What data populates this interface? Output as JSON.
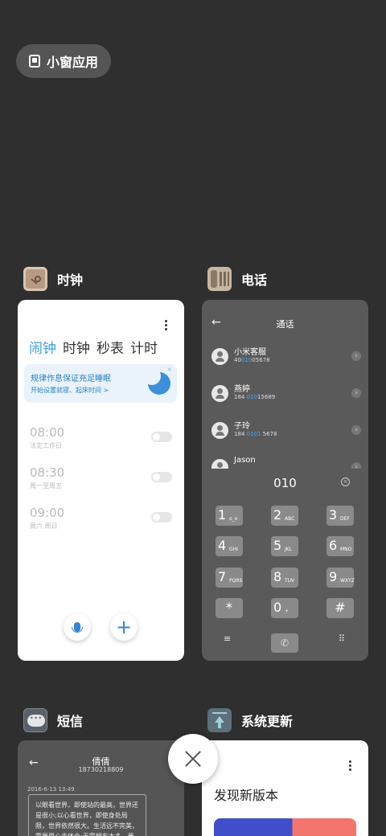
{
  "mini_apps": {
    "label": "小窗应用"
  },
  "apps": {
    "clock": {
      "title": "时钟"
    },
    "phone": {
      "title": "电话"
    },
    "sms": {
      "title": "短信"
    },
    "update": {
      "title": "系统更新"
    }
  },
  "clock": {
    "tabs": [
      "闹钟",
      "时钟",
      "秒表",
      "计时"
    ],
    "active_tab": "闹钟",
    "tip_title": "规律作息保证充足睡眠",
    "tip_sub": "开始设置就寝、起床时间 >",
    "tip_close": "×",
    "alarms": [
      {
        "time": "08:00",
        "sub": "法定工作日",
        "enabled": false
      },
      {
        "time": "08:30",
        "sub": "周一至周五",
        "enabled": false
      },
      {
        "time": "09:00",
        "sub": "周六 周日",
        "enabled": false
      }
    ],
    "plus": "+"
  },
  "phone": {
    "back": "←",
    "title": "通话",
    "contacts": [
      {
        "name": "小米客服",
        "num_pre": "40",
        "num_hl": "010",
        "num_post": "05678"
      },
      {
        "name": "燕婷",
        "num_pre": "184 ",
        "num_hl": "010",
        "num_post": "15689"
      },
      {
        "name": "子玲",
        "num_pre": "184 ",
        "num_hl": "0101",
        "num_post": " 5678"
      },
      {
        "name": "Jason",
        "num_pre": "",
        "num_hl": "",
        "num_post": ""
      }
    ],
    "chevron": "›",
    "dial_number": "010",
    "delete": "×",
    "keys": [
      {
        "d": "1",
        "l": "o_o"
      },
      {
        "d": "2",
        "l": "ABC"
      },
      {
        "d": "3",
        "l": "DEF"
      },
      {
        "d": "4",
        "l": "GHI"
      },
      {
        "d": "5",
        "l": "JKL"
      },
      {
        "d": "6",
        "l": "MNO"
      },
      {
        "d": "7",
        "l": "PQRS"
      },
      {
        "d": "8",
        "l": "TUV"
      },
      {
        "d": "9",
        "l": "WXYZ"
      },
      {
        "d": "*",
        "l": ""
      },
      {
        "d": "0",
        "l": "+"
      },
      {
        "d": "#",
        "l": ""
      }
    ],
    "menu": "≡",
    "call": "✆",
    "dialpad": "⠿"
  },
  "sms": {
    "back": "←",
    "name": "倩倩",
    "number": "18730218809",
    "date": "2016-6-13 13:49",
    "message": "以眼看世界，即使站的最高，世界还是很小;以心看世界，即使身处局限，世界依然很大。生活远不完美，需要用心去体会;无需想有太多，要"
  },
  "update": {
    "title": "发现新版本"
  },
  "colors": {
    "background": "#2f2f2f",
    "accent_blue": "#3aa0e6",
    "phone_card": "#5a5a5a"
  }
}
